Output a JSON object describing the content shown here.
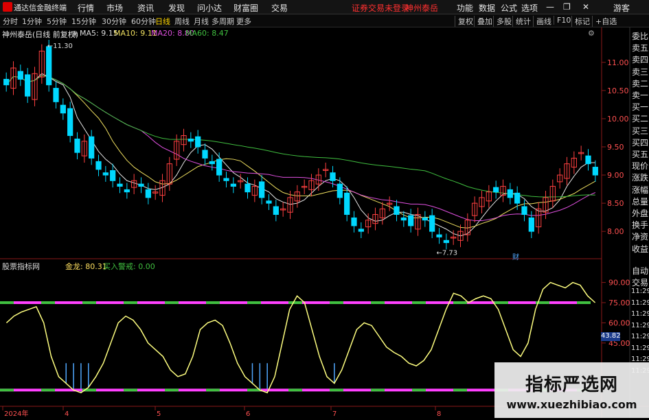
{
  "app": {
    "title": "通达信金融终端",
    "trade_status": "证券交易未登录",
    "stock_name_tab": "神州泰岳",
    "guest": "游客"
  },
  "menu": [
    "行情",
    "市场",
    "资讯",
    "发现",
    "问小达",
    "财富圈",
    "交易"
  ],
  "menu_right": [
    "功能",
    "数据",
    "公式",
    "选项"
  ],
  "periods": [
    "分时",
    "1分钟",
    "5分钟",
    "15分钟",
    "30分钟",
    "60分钟",
    "日线",
    "周线",
    "月线",
    "多周期",
    "更多"
  ],
  "active_period": "日线",
  "toolbar_right": [
    "复权",
    "叠加",
    "多股",
    "统计",
    "画线",
    "F10",
    "标记",
    "+自选"
  ],
  "main_panel": {
    "title": "神州泰岳(日线 前复权)",
    "ma": [
      {
        "label": "MA5: 9.15",
        "color": "#e8e8e8"
      },
      {
        "label": "MA10: 9.11",
        "color": "#f0e060"
      },
      {
        "label": "MA20: 8.80",
        "color": "#e050e0"
      },
      {
        "label": "MA60: 8.47",
        "color": "#40c040"
      }
    ],
    "high_mark": "11.30",
    "low_mark": "7.73",
    "price_ticks": [
      "11.00",
      "10.50",
      "10.00",
      "9.50",
      "9.00",
      "8.50",
      "8.00"
    ],
    "ylim": [
      7.6,
      11.4
    ],
    "marker_left": "",
    "marker_cai": "财"
  },
  "sub_panel": {
    "title": "股票指标网",
    "values": [
      {
        "label": "金龙: 80.31",
        "color": "#ffe060"
      },
      {
        "label": "买入警戒: 0.00",
        "color": "#40c040"
      }
    ],
    "ticks": [
      "90.00",
      "75.00",
      "60.00",
      "45.00"
    ],
    "current_value": "43.82",
    "ylim": [
      0,
      100
    ]
  },
  "x_labels": [
    "2024年",
    "4",
    "5",
    "6",
    "7",
    "8"
  ],
  "side_panel": [
    "委比",
    "卖五",
    "卖四",
    "卖三",
    "卖二",
    "卖一",
    "买一",
    "买二",
    "买三",
    "买四",
    "买五",
    "现价",
    "涨跌",
    "涨幅",
    "总量",
    "外盘",
    "换手",
    "净资",
    "收益"
  ],
  "side_panel_bottom": [
    "自动",
    "交易",
    "11:29",
    "11:29",
    "11:29",
    "11:29",
    "11:29",
    "11:29",
    "11:29",
    "11:29"
  ],
  "watermark": {
    "line1": "指标严选网",
    "line2": "www.xuezhibiao.com"
  },
  "colors": {
    "up": "#ff4040",
    "down": "#00d8ff",
    "ma5": "#e8e8e8",
    "ma10": "#f0e060",
    "ma20": "#e050e0",
    "ma60": "#40c040",
    "signal": "#ffff80",
    "band": "#ff40ff",
    "bar": "#50a8ff"
  },
  "chart_data": {
    "type": "candlestick",
    "close": [
      10.6,
      10.9,
      10.7,
      10.4,
      10.8,
      11.2,
      10.6,
      10.3,
      10.1,
      9.7,
      9.4,
      9.6,
      9.3,
      9.1,
      9.0,
      8.9,
      8.8,
      8.7,
      8.9,
      8.8,
      8.6,
      8.7,
      8.9,
      9.2,
      9.6,
      9.7,
      9.6,
      9.5,
      9.3,
      9.2,
      9.0,
      8.9,
      8.8,
      8.9,
      8.7,
      8.8,
      8.6,
      8.5,
      8.3,
      8.4,
      8.6,
      8.7,
      8.8,
      8.9,
      9.0,
      9.1,
      8.9,
      8.6,
      8.3,
      8.1,
      8.0,
      8.2,
      8.3,
      8.4,
      8.5,
      8.3,
      8.2,
      8.1,
      8.3,
      8.2,
      8.0,
      7.9,
      7.8,
      7.9,
      8.0,
      8.2,
      8.5,
      8.6,
      8.7,
      8.7,
      8.8,
      8.6,
      8.5,
      8.3,
      8.0,
      8.4,
      8.6,
      8.8,
      9.0,
      9.2,
      9.3,
      9.4,
      9.2,
      9.0
    ],
    "signal": [
      60,
      65,
      68,
      70,
      72,
      60,
      35,
      20,
      15,
      10,
      8,
      12,
      20,
      30,
      45,
      60,
      65,
      62,
      55,
      45,
      40,
      35,
      25,
      20,
      22,
      35,
      55,
      60,
      62,
      58,
      45,
      30,
      20,
      15,
      10,
      8,
      20,
      45,
      70,
      80,
      75,
      55,
      35,
      20,
      15,
      25,
      40,
      55,
      60,
      58,
      50,
      42,
      38,
      35,
      30,
      28,
      32,
      40,
      55,
      70,
      82,
      80,
      75,
      78,
      80,
      78,
      70,
      55,
      40,
      35,
      45,
      70,
      85,
      90,
      88,
      86,
      90,
      88,
      80,
      75
    ]
  }
}
